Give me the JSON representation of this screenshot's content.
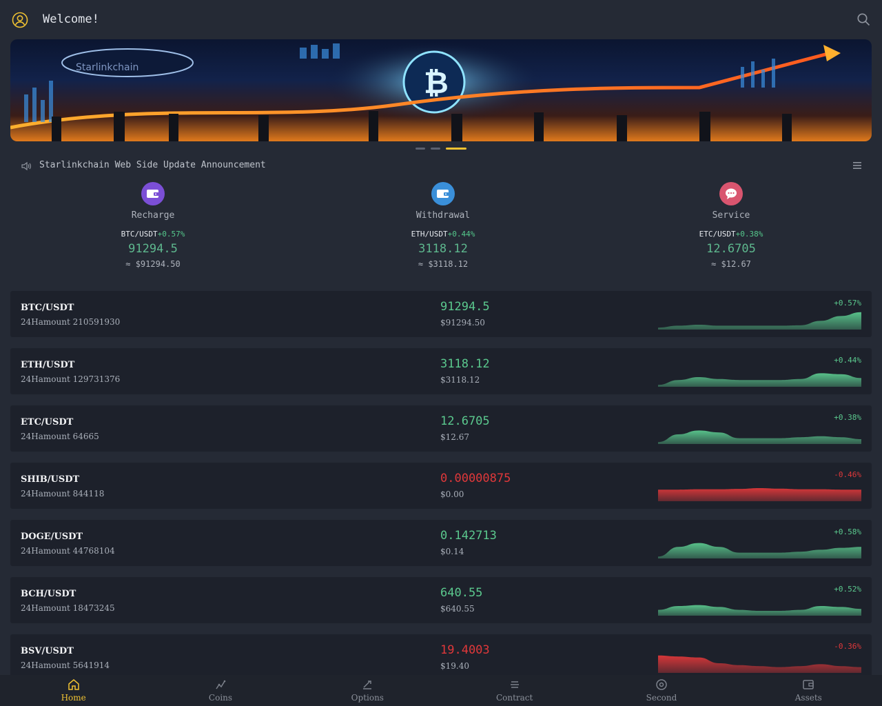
{
  "header": {
    "welcome": "Welcome!"
  },
  "banner": {
    "logo_text": "Starlinkchain"
  },
  "announcement": {
    "text": "Starlinkchain Web Side Update Announcement"
  },
  "quick_actions": [
    {
      "label": "Recharge",
      "pair": "BTC/USDT",
      "change": "+0.57%",
      "price": "91294.5",
      "usd": "≈ $91294.50",
      "color": "#7b4fd6"
    },
    {
      "label": "Withdrawal",
      "pair": "ETH/USDT",
      "change": "+0.44%",
      "price": "3118.12",
      "usd": "≈ $3118.12",
      "color": "#3a8fd9"
    },
    {
      "label": "Service",
      "pair": "ETC/USDT",
      "change": "+0.38%",
      "price": "12.6705",
      "usd": "≈ $12.67",
      "color": "#d9556f"
    }
  ],
  "market": [
    {
      "pair": "BTC/USDT",
      "amount": "24Hamount 210591930",
      "price": "91294.5",
      "usd": "$91294.50",
      "change": "+0.57%",
      "trend": "up",
      "spark": [
        0.1,
        0.2,
        0.25,
        0.2,
        0.2,
        0.2,
        0.2,
        0.22,
        0.45,
        0.7,
        0.9
      ]
    },
    {
      "pair": "ETH/USDT",
      "amount": "24Hamount 129731376",
      "price": "3118.12",
      "usd": "$3118.12",
      "change": "+0.44%",
      "trend": "up",
      "spark": [
        0.1,
        0.35,
        0.5,
        0.4,
        0.35,
        0.35,
        0.35,
        0.4,
        0.7,
        0.65,
        0.45
      ]
    },
    {
      "pair": "ETC/USDT",
      "amount": "24Hamount 64665",
      "price": "12.6705",
      "usd": "$12.67",
      "change": "+0.38%",
      "trend": "up",
      "spark": [
        0.1,
        0.5,
        0.7,
        0.6,
        0.3,
        0.3,
        0.3,
        0.35,
        0.4,
        0.35,
        0.25
      ]
    },
    {
      "pair": "SHIB/USDT",
      "amount": "24Hamount 844118",
      "price": "0.00000875",
      "usd": "$0.00",
      "change": "-0.46%",
      "trend": "down",
      "spark": [
        0.6,
        0.6,
        0.62,
        0.62,
        0.64,
        0.68,
        0.65,
        0.62,
        0.62,
        0.6,
        0.6
      ]
    },
    {
      "pair": "DOGE/USDT",
      "amount": "24Hamount 44768104",
      "price": "0.142713",
      "usd": "$0.14",
      "change": "+0.58%",
      "trend": "up",
      "spark": [
        0.1,
        0.6,
        0.8,
        0.6,
        0.3,
        0.3,
        0.3,
        0.35,
        0.45,
        0.55,
        0.6
      ]
    },
    {
      "pair": "BCH/USDT",
      "amount": "24Hamount 18473245",
      "price": "640.55",
      "usd": "$640.55",
      "change": "+0.52%",
      "trend": "up",
      "spark": [
        0.3,
        0.5,
        0.55,
        0.45,
        0.3,
        0.25,
        0.25,
        0.3,
        0.5,
        0.45,
        0.35
      ]
    },
    {
      "pair": "BSV/USDT",
      "amount": "24Hamount 5641914",
      "price": "19.4003",
      "usd": "$19.40",
      "change": "-0.36%",
      "trend": "down",
      "spark": [
        0.9,
        0.85,
        0.8,
        0.5,
        0.4,
        0.35,
        0.3,
        0.35,
        0.45,
        0.35,
        0.3
      ]
    }
  ],
  "tabs": [
    {
      "label": "Home",
      "icon": "home-icon",
      "active": true
    },
    {
      "label": "Coins",
      "icon": "coins-icon",
      "active": false
    },
    {
      "label": "Options",
      "icon": "options-icon",
      "active": false
    },
    {
      "label": "Contract",
      "icon": "contract-icon",
      "active": false
    },
    {
      "label": "Second",
      "icon": "second-icon",
      "active": false
    },
    {
      "label": "Assets",
      "icon": "assets-icon",
      "active": false
    }
  ],
  "colors": {
    "up": "#5bc98e",
    "down": "#e0383a",
    "accent": "#f0c232"
  }
}
